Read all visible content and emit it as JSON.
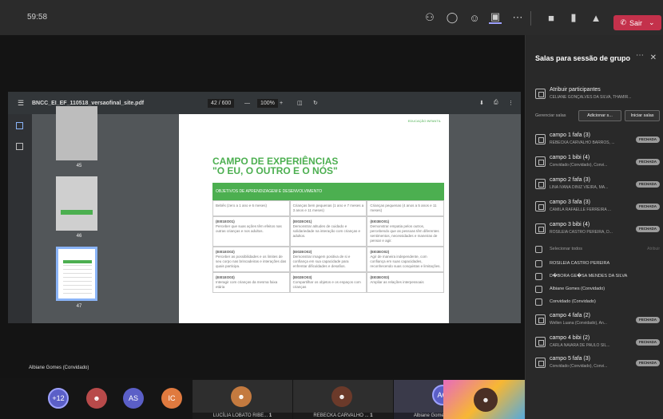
{
  "topbar": {
    "time": "59:58",
    "leave_label": "Sair"
  },
  "viewer": {
    "filename": "BNCC_EI_EF_110518_versaofinal_site.pdf",
    "page_indicator": "42 / 600",
    "zoom": "100%",
    "thumbs": [
      {
        "num": "45"
      },
      {
        "num": "46"
      },
      {
        "num": "47"
      }
    ]
  },
  "page": {
    "header": "EDUCAÇÃO INFANTIL",
    "title_line1": "CAMPO DE EXPERIÊNCIAS",
    "title_line2": "\"O EU, O OUTRO E O NÓS\"",
    "banner": "OBJETIVOS DE APRENDIZAGEM E DESENVOLVIMENTO",
    "cols": [
      "Bebês (zero a 1 ano e 6 meses)",
      "Crianças bem pequenas (1 ano e 7 meses a 3 anos e 11 meses)",
      "Crianças pequenas (4 anos a 5 anos e 11 meses)"
    ],
    "rows": [
      [
        {
          "code": "(EI01EO01)",
          "text": "Perceber que suas ações têm efeitos nas outras crianças e nos adultos."
        },
        {
          "code": "(EI02EO01)",
          "text": "Demonstrar atitudes de cuidado e solidariedade na interação com crianças e adultos."
        },
        {
          "code": "(EI03EO01)",
          "text": "Demonstrar empatia pelos outros, percebendo que as pessoas têm diferentes sentimentos, necessidades e maneiras de pensar e agir."
        }
      ],
      [
        {
          "code": "(EI01EO02)",
          "text": "Perceber as possibilidades e os limites de seu corpo nas brincadeiras e interações das quais participa."
        },
        {
          "code": "(EI02EO02)",
          "text": "Demonstrar imagem positiva de si e confiança em sua capacidade para enfrentar dificuldades e desafios."
        },
        {
          "code": "(EI03EO02)",
          "text": "Agir de maneira independente, com confiança em suas capacidades, reconhecendo suas conquistas e limitações."
        }
      ],
      [
        {
          "code": "(EI01EO03)",
          "text": "Interagir com crianças da mesma faixa etária"
        },
        {
          "code": "(EI02EO03)",
          "text": "Compartilhar os objetos e os espaços com crianças"
        },
        {
          "code": "(EI03EO03)",
          "text": "Ampliar as relações interpessoais"
        }
      ]
    ]
  },
  "presenter": "Albiane Gomes (Convidado)",
  "strip": {
    "more": "+12",
    "initials": [
      "AS",
      "IC"
    ],
    "tiles": [
      {
        "name": "LUCÍLIA LOBATO RIBE...",
        "count": "1"
      },
      {
        "name": "REBECKA CARVALHO ...",
        "count": "1"
      },
      {
        "name": "Albiane Gomes (Convidado)",
        "initials": "AG"
      }
    ]
  },
  "panel": {
    "title": "Salas para sessão de grupo",
    "assign_title": "Atribuir participantes",
    "assign_sub": "CELIANE GONÇALVES DA SILVA, THAMIR...",
    "manage_label": "Gerenciar salas",
    "add_label": "Adicionar s...",
    "start_label": "Iniciar salas",
    "rooms_top": [
      {
        "name": "campo 1 fafa (3)",
        "sub": "REBECKA CARVALHO BARROS, ...",
        "badge": "FECHADA"
      },
      {
        "name": "campo 1 bibi (4)",
        "sub": "Convidado (Convidado), Convi...",
        "badge": "FECHADA"
      },
      {
        "name": "campo 2 fafa (3)",
        "sub": "LINA IVANA DINIZ VIEIRA, MA...",
        "badge": "FECHADA"
      },
      {
        "name": "campo 3 fafa (3)",
        "sub": "CAMILA RAFAELLE FERREIRA ...",
        "badge": "FECHADA"
      },
      {
        "name": "campo 3 bibi (4)",
        "sub": "ROSILEIA CASTRO PEREIRA, D...",
        "badge": "FECHADA"
      }
    ],
    "select_all": "Selecionar todos",
    "assign_btn": "Atribuir",
    "people": [
      "ROSILEIA CASTRO PEREIRA",
      "D�BORA GE�SA MENDES DA SILVA",
      "Albiane Gomes (Convidado)",
      "Convidado (Convidado)"
    ],
    "rooms_bottom": [
      {
        "name": "campo 4 fafa (2)",
        "sub": "Wellen Luana (Convidado), An...",
        "badge": "FECHADA"
      },
      {
        "name": "campo 4 bibi (2)",
        "sub": "CARLA NAIARA DE PAULO SIL...",
        "badge": "FECHADA"
      },
      {
        "name": "campo 5 fafa (3)",
        "sub": "Convidado (Convidado), Convi...",
        "badge": "FECHADA"
      }
    ]
  },
  "colors": {
    "accent": "#4caf50",
    "leave": "#c4314b",
    "teams": "#5b5fc7"
  }
}
